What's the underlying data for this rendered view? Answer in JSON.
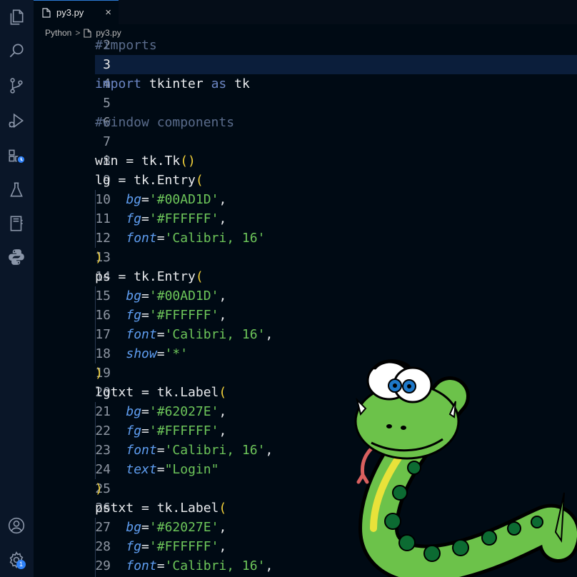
{
  "tab": {
    "filename": "py3.py",
    "close_glyph": "×"
  },
  "breadcrumb": {
    "language": "Python",
    "separator": ">",
    "file": "py3.py"
  },
  "activity_bar": {
    "top_icons": [
      "files-icon",
      "search-icon",
      "source-control-icon",
      "run-debug-icon",
      "extensions-icon",
      "testing-icon",
      "notebook-icon",
      "python-icon"
    ],
    "bottom_icons": [
      "account-icon",
      "settings-gear-icon"
    ],
    "settings_badge": "1"
  },
  "colors": {
    "editor_bg": "#000a14",
    "activity_bg": "#0a1628",
    "current_line": "#0b1e3b",
    "comment": "#5a6c8c",
    "keyword": "#6c86c4",
    "paren": "#f3d23a",
    "param": "#5e9df0",
    "string": "#6dc65a"
  },
  "editor": {
    "active_line": "3",
    "lines": [
      {
        "num": "2",
        "tokens": [
          {
            "t": "#imports",
            "c": "comment"
          }
        ]
      },
      {
        "num": "3",
        "tokens": []
      },
      {
        "num": "4",
        "tokens": [
          {
            "t": "import",
            "c": "kw"
          },
          {
            "t": " tkinter ",
            "c": "ident"
          },
          {
            "t": "as",
            "c": "kw"
          },
          {
            "t": " tk",
            "c": "ident"
          }
        ]
      },
      {
        "num": "5",
        "tokens": []
      },
      {
        "num": "6",
        "tokens": [
          {
            "t": "#window components",
            "c": "comment"
          }
        ]
      },
      {
        "num": "7",
        "tokens": []
      },
      {
        "num": "8",
        "tokens": [
          {
            "t": "win = tk.Tk",
            "c": "ident"
          },
          {
            "t": "()",
            "c": "paren"
          }
        ]
      },
      {
        "num": "9",
        "tokens": [
          {
            "t": "lg = tk.Entry",
            "c": "ident"
          },
          {
            "t": "(",
            "c": "paren"
          }
        ]
      },
      {
        "num": "10",
        "tokens": [
          {
            "t": "    ",
            "c": "ident"
          },
          {
            "t": "bg",
            "c": "param"
          },
          {
            "t": "=",
            "c": "ident"
          },
          {
            "t": "'#00AD1D'",
            "c": "str"
          },
          {
            "t": ",",
            "c": "ident"
          }
        ]
      },
      {
        "num": "11",
        "tokens": [
          {
            "t": "    ",
            "c": "ident"
          },
          {
            "t": "fg",
            "c": "param"
          },
          {
            "t": "=",
            "c": "ident"
          },
          {
            "t": "'#FFFFFF'",
            "c": "str"
          },
          {
            "t": ",",
            "c": "ident"
          }
        ]
      },
      {
        "num": "12",
        "tokens": [
          {
            "t": "    ",
            "c": "ident"
          },
          {
            "t": "font",
            "c": "param"
          },
          {
            "t": "=",
            "c": "ident"
          },
          {
            "t": "'Calibri, 16'",
            "c": "str"
          }
        ]
      },
      {
        "num": "13",
        "tokens": [
          {
            "t": ")",
            "c": "paren"
          }
        ]
      },
      {
        "num": "14",
        "tokens": [
          {
            "t": "ps = tk.Entry",
            "c": "ident"
          },
          {
            "t": "(",
            "c": "paren"
          }
        ]
      },
      {
        "num": "15",
        "tokens": [
          {
            "t": "    ",
            "c": "ident"
          },
          {
            "t": "bg",
            "c": "param"
          },
          {
            "t": "=",
            "c": "ident"
          },
          {
            "t": "'#00AD1D'",
            "c": "str"
          },
          {
            "t": ",",
            "c": "ident"
          }
        ]
      },
      {
        "num": "16",
        "tokens": [
          {
            "t": "    ",
            "c": "ident"
          },
          {
            "t": "fg",
            "c": "param"
          },
          {
            "t": "=",
            "c": "ident"
          },
          {
            "t": "'#FFFFFF'",
            "c": "str"
          },
          {
            "t": ",",
            "c": "ident"
          }
        ]
      },
      {
        "num": "17",
        "tokens": [
          {
            "t": "    ",
            "c": "ident"
          },
          {
            "t": "font",
            "c": "param"
          },
          {
            "t": "=",
            "c": "ident"
          },
          {
            "t": "'Calibri, 16'",
            "c": "str"
          },
          {
            "t": ",",
            "c": "ident"
          }
        ]
      },
      {
        "num": "18",
        "tokens": [
          {
            "t": "    ",
            "c": "ident"
          },
          {
            "t": "show",
            "c": "param"
          },
          {
            "t": "=",
            "c": "ident"
          },
          {
            "t": "'*'",
            "c": "str"
          }
        ]
      },
      {
        "num": "19",
        "tokens": [
          {
            "t": ")",
            "c": "paren"
          }
        ]
      },
      {
        "num": "20",
        "tokens": [
          {
            "t": "lgtxt = tk.Label",
            "c": "ident"
          },
          {
            "t": "(",
            "c": "paren"
          }
        ]
      },
      {
        "num": "21",
        "tokens": [
          {
            "t": "    ",
            "c": "ident"
          },
          {
            "t": "bg",
            "c": "param"
          },
          {
            "t": "=",
            "c": "ident"
          },
          {
            "t": "'#62027E'",
            "c": "str"
          },
          {
            "t": ",",
            "c": "ident"
          }
        ]
      },
      {
        "num": "22",
        "tokens": [
          {
            "t": "    ",
            "c": "ident"
          },
          {
            "t": "fg",
            "c": "param"
          },
          {
            "t": "=",
            "c": "ident"
          },
          {
            "t": "'#FFFFFF'",
            "c": "str"
          },
          {
            "t": ",",
            "c": "ident"
          }
        ]
      },
      {
        "num": "23",
        "tokens": [
          {
            "t": "    ",
            "c": "ident"
          },
          {
            "t": "font",
            "c": "param"
          },
          {
            "t": "=",
            "c": "ident"
          },
          {
            "t": "'Calibri, 16'",
            "c": "str"
          },
          {
            "t": ",",
            "c": "ident"
          }
        ]
      },
      {
        "num": "24",
        "tokens": [
          {
            "t": "    ",
            "c": "ident"
          },
          {
            "t": "text",
            "c": "param"
          },
          {
            "t": "=",
            "c": "ident"
          },
          {
            "t": "\"Login\"",
            "c": "str"
          }
        ]
      },
      {
        "num": "25",
        "tokens": [
          {
            "t": ")",
            "c": "paren"
          }
        ]
      },
      {
        "num": "26",
        "tokens": [
          {
            "t": "pstxt = tk.Label",
            "c": "ident"
          },
          {
            "t": "(",
            "c": "paren"
          }
        ]
      },
      {
        "num": "27",
        "tokens": [
          {
            "t": "    ",
            "c": "ident"
          },
          {
            "t": "bg",
            "c": "param"
          },
          {
            "t": "=",
            "c": "ident"
          },
          {
            "t": "'#62027E'",
            "c": "str"
          },
          {
            "t": ",",
            "c": "ident"
          }
        ]
      },
      {
        "num": "28",
        "tokens": [
          {
            "t": "    ",
            "c": "ident"
          },
          {
            "t": "fg",
            "c": "param"
          },
          {
            "t": "=",
            "c": "ident"
          },
          {
            "t": "'#FFFFFF'",
            "c": "str"
          },
          {
            "t": ",",
            "c": "ident"
          }
        ]
      },
      {
        "num": "29",
        "tokens": [
          {
            "t": "    ",
            "c": "ident"
          },
          {
            "t": "font",
            "c": "param"
          },
          {
            "t": "=",
            "c": "ident"
          },
          {
            "t": "'Calibri, 16'",
            "c": "str"
          },
          {
            "t": ",",
            "c": "ident"
          }
        ]
      }
    ]
  },
  "overlay": {
    "image": "cartoon-snake-mascot"
  }
}
